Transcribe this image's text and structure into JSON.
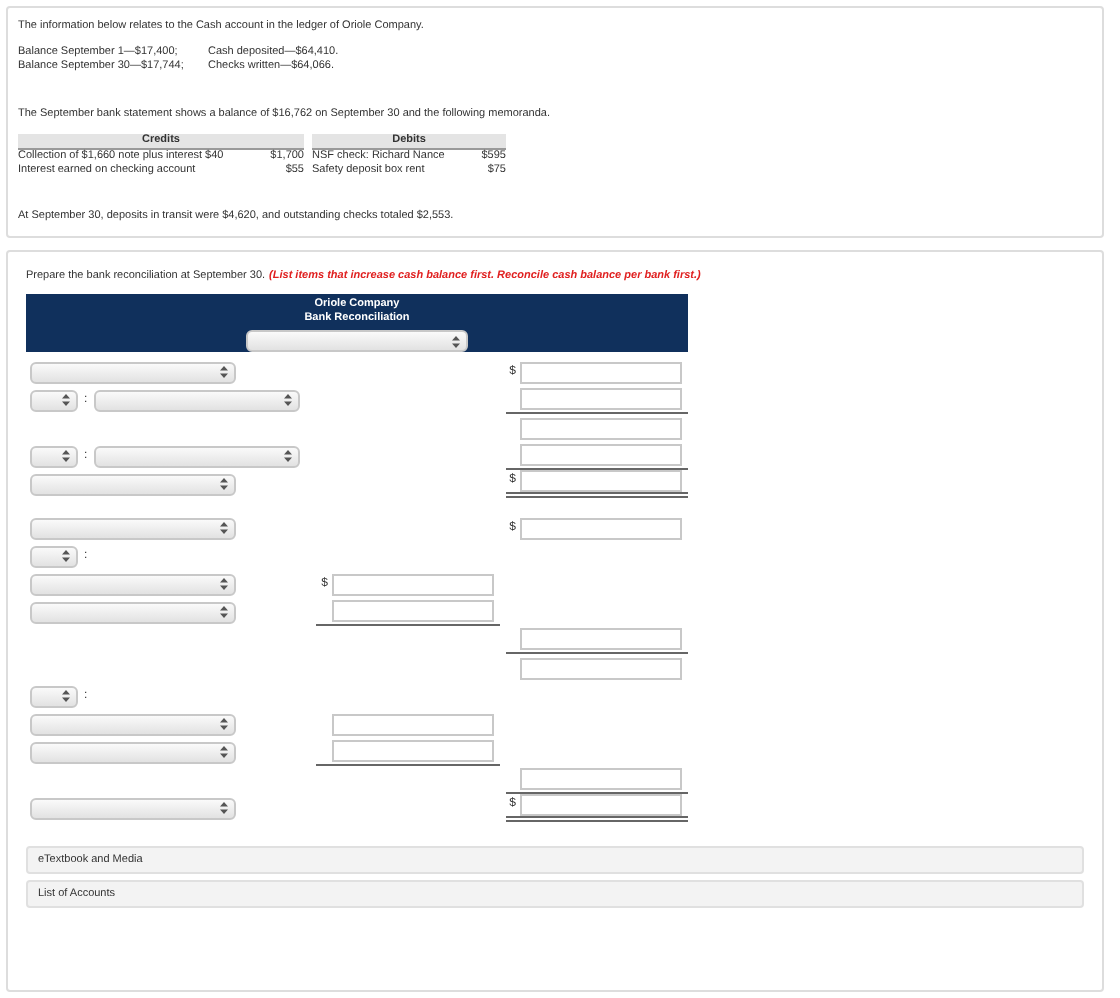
{
  "problem": {
    "intro": "The information below relates to the Cash account in the ledger of Oriole Company.",
    "ledger": [
      [
        "Balance September 1—$17,400;",
        "Cash deposited—$64,410."
      ],
      [
        "Balance September 30—$17,744;",
        "Checks written—$64,066."
      ]
    ],
    "statement": "The September bank statement shows a balance of $16,762 on September 30 and the following memoranda.",
    "memo": {
      "credits_heading": "Credits",
      "debits_heading": "Debits",
      "rows": [
        [
          "Collection of $1,660 note plus interest $40",
          "$1,700",
          "NSF check: Richard Nance",
          "$595"
        ],
        [
          "Interest earned on checking account",
          "$55",
          "Safety deposit box rent",
          "$75"
        ]
      ]
    },
    "closing": "At September 30, deposits in transit were $4,620, and outstanding checks totaled $2,553."
  },
  "instruction": {
    "text": "Prepare the bank reconciliation at September 30.",
    "note": "(List items that increase cash balance first. Reconcile cash balance per bank first.)"
  },
  "reconciliation": {
    "company": "Oriole Company",
    "title": "Bank Reconciliation",
    "sections": [
      [
        {
          "kind": "select",
          "amount": {
            "kind": "outer",
            "currency": "$"
          }
        },
        {
          "kind": "pair",
          "colon": ":",
          "amount": {
            "kind": "outer",
            "rule": {
              "kind": "single"
            }
          }
        },
        {
          "kind": "blank",
          "amount": {
            "kind": "outer"
          }
        },
        {
          "kind": "pair",
          "colon": ":",
          "amount": {
            "kind": "outer",
            "rule": {
              "kind": "single"
            }
          }
        },
        {
          "kind": "select",
          "amount": {
            "kind": "outer",
            "currency": "$",
            "rule": {
              "kind": "double"
            }
          }
        }
      ],
      [
        {
          "kind": "select",
          "amount": {
            "kind": "outer",
            "currency": "$"
          }
        },
        {
          "kind": "prefix",
          "colon": ":"
        },
        {
          "kind": "select",
          "amount": {
            "kind": "inner",
            "currency": "$"
          }
        },
        {
          "kind": "select",
          "amount": {
            "kind": "inner",
            "rule": {
              "kind": "single"
            }
          }
        },
        {
          "kind": "blank",
          "amount": {
            "kind": "outer",
            "rule": {
              "kind": "single"
            }
          }
        },
        {
          "kind": "blank",
          "amount": {
            "kind": "outer"
          }
        },
        {
          "kind": "prefix",
          "colon": ":"
        },
        {
          "kind": "select",
          "amount": {
            "kind": "inner"
          }
        },
        {
          "kind": "select",
          "amount": {
            "kind": "inner",
            "rule": {
              "kind": "single"
            }
          }
        },
        {
          "kind": "blank",
          "amount": {
            "kind": "outer",
            "rule": {
              "kind": "single"
            }
          }
        },
        {
          "kind": "select",
          "amount": {
            "kind": "outer",
            "currency": "$",
            "rule": {
              "kind": "double"
            }
          }
        }
      ]
    ]
  },
  "links": [
    "eTextbook and Media",
    "List of Accounts"
  ]
}
